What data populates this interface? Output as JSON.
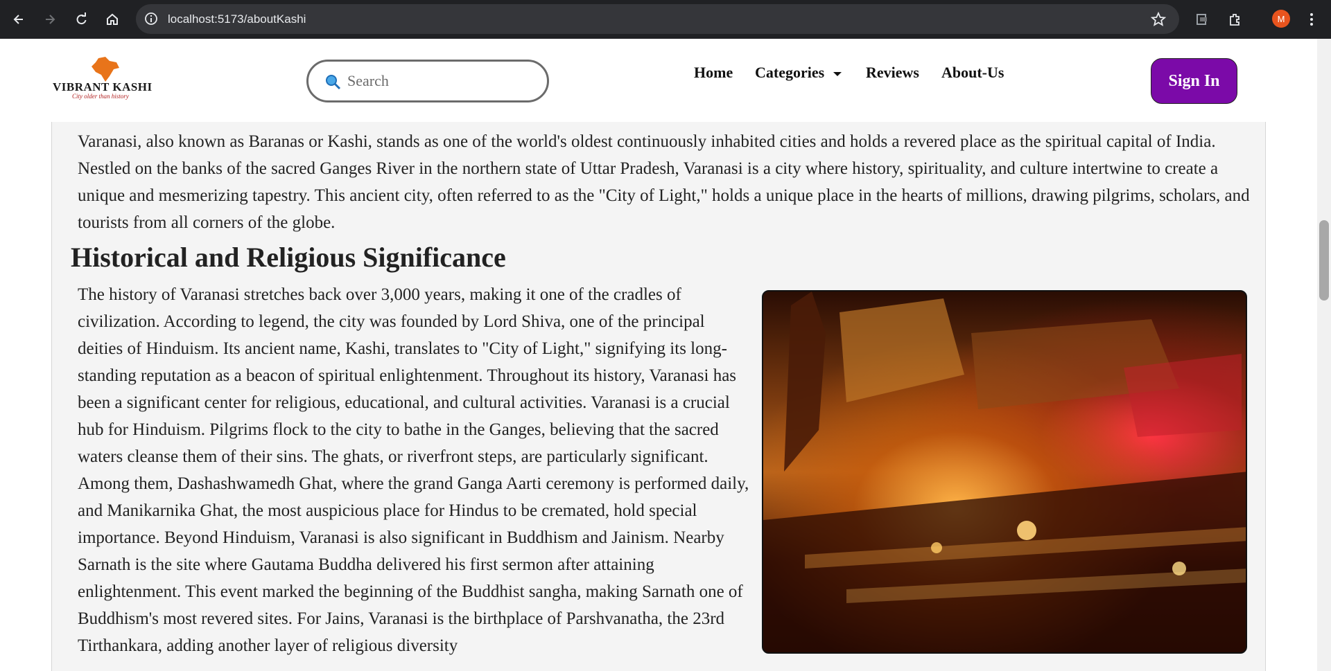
{
  "browser": {
    "url": "localhost:5173/aboutKashi",
    "profile_initial": "M"
  },
  "logo": {
    "wordmark": "VIBRANT KASHI",
    "tagline": "City older than history"
  },
  "search": {
    "placeholder": "Search"
  },
  "nav": {
    "home": "Home",
    "categories": "Categories",
    "reviews": "Reviews",
    "about": "About-Us"
  },
  "sign_in_label": "Sign In",
  "content": {
    "intro": "Varanasi, also known as Baranas or Kashi, stands as one of the world's oldest continuously inhabited cities and holds a revered place as the spiritual capital of India. Nestled on the banks of the sacred Ganges River in the northern state of Uttar Pradesh, Varanasi is a city where history, spirituality, and culture intertwine to create a unique and mesmerizing tapestry. This ancient city, often referred to as the \"City of Light,\" holds a unique place in the hearts of millions, drawing pilgrims, scholars, and tourists from all corners of the globe.",
    "section_heading": "Historical and Religious Significance",
    "history": "The history of Varanasi stretches back over 3,000 years, making it one of the cradles of civilization. According to legend, the city was founded by Lord Shiva, one of the principal deities of Hinduism. Its ancient name, Kashi, translates to \"City of Light,\" signifying its long-standing reputation as a beacon of spiritual enlightenment. Throughout its history, Varanasi has been a significant center for religious, educational, and cultural activities. Varanasi is a crucial hub for Hinduism. Pilgrims flock to the city to bathe in the Ganges, believing that the sacred waters cleanse them of their sins. The ghats, or riverfront steps, are particularly significant. Among them, Dashashwamedh Ghat, where the grand Ganga Aarti ceremony is performed daily, and Manikarnika Ghat, the most auspicious place for Hindus to be cremated, hold special importance. Beyond Hinduism, Varanasi is also significant in Buddhism and Jainism. Nearby Sarnath is the site where Gautama Buddha delivered his first sermon after attaining enlightenment. This event marked the beginning of the Buddhist sangha, making Sarnath one of Buddhism's most revered sites. For Jains, Varanasi is the birthplace of Parshvanatha, the 23rd Tirthankara, adding another layer of religious diversity"
  },
  "colors": {
    "sign_in_bg": "#7b0aa8",
    "chrome_bg": "#202124",
    "panel_bg": "#f4f4f4"
  }
}
